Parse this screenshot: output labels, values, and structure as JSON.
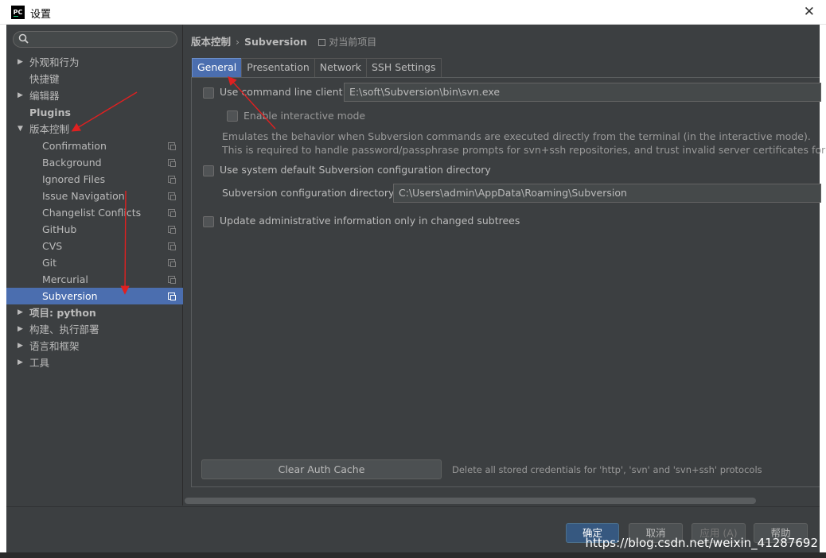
{
  "window": {
    "title": "设置",
    "app_icon_text": "PC"
  },
  "sidebar": {
    "search": {
      "placeholder": "",
      "value": ""
    },
    "items": [
      {
        "label": "外观和行为",
        "arrow": "▶"
      },
      {
        "label": "快捷键"
      },
      {
        "label": "编辑器",
        "arrow": "▶"
      },
      {
        "label": "Plugins"
      },
      {
        "label": "版本控制",
        "arrow": "▼"
      },
      {
        "label": "Confirmation"
      },
      {
        "label": "Background"
      },
      {
        "label": "Ignored Files"
      },
      {
        "label": "Issue Navigation"
      },
      {
        "label": "Changelist Conflicts"
      },
      {
        "label": "GitHub"
      },
      {
        "label": "CVS"
      },
      {
        "label": "Git"
      },
      {
        "label": "Mercurial"
      },
      {
        "label": "Subversion"
      },
      {
        "label": "项目: python",
        "arrow": "▶"
      },
      {
        "label": "构建、执行部署",
        "arrow": "▶"
      },
      {
        "label": "语言和框架",
        "arrow": "▶"
      },
      {
        "label": "工具",
        "arrow": "▶"
      }
    ]
  },
  "breadcrumb": {
    "parent": "版本控制",
    "separator": "›",
    "current": "Subversion",
    "scope": "对当前项目"
  },
  "tabs": [
    "General",
    "Presentation",
    "Network",
    "SSH Settings"
  ],
  "general": {
    "use_cmd_client": {
      "label": "Use command line client:",
      "checked": false
    },
    "cmd_client_path": "E:\\soft\\Subversion\\bin\\svn.exe",
    "interactive_mode": {
      "label": "Enable interactive mode",
      "checked": false
    },
    "description_line1": "Emulates the behavior when Subversion commands are executed directly from the terminal (in the interactive mode).",
    "description_line2": "This is required to handle password/passphrase prompts for svn+ssh repositories, and trust invalid server certificates for https r",
    "use_default_config": {
      "label": "Use system default Subversion configuration directory",
      "checked": false
    },
    "config_dir_label": "Subversion configuration directory:",
    "config_dir_path": "C:\\Users\\admin\\AppData\\Roaming\\Subversion",
    "update_admin_info": {
      "label": "Update administrative information only in changed subtrees",
      "checked": false
    },
    "clear_auth_button": "Clear Auth Cache",
    "clear_auth_hint": "Delete all stored credentials for 'http', 'svn' and 'svn+ssh' protocols"
  },
  "footer": {
    "ok": "确定",
    "cancel": "取消",
    "apply": "应用 (A)",
    "help": "帮助"
  },
  "watermark": "https://blog.csdn.net/weixin_41287692",
  "colors": {
    "background": "#3c3f41",
    "selection": "#4b6eaf",
    "annotation": "#e02020"
  }
}
